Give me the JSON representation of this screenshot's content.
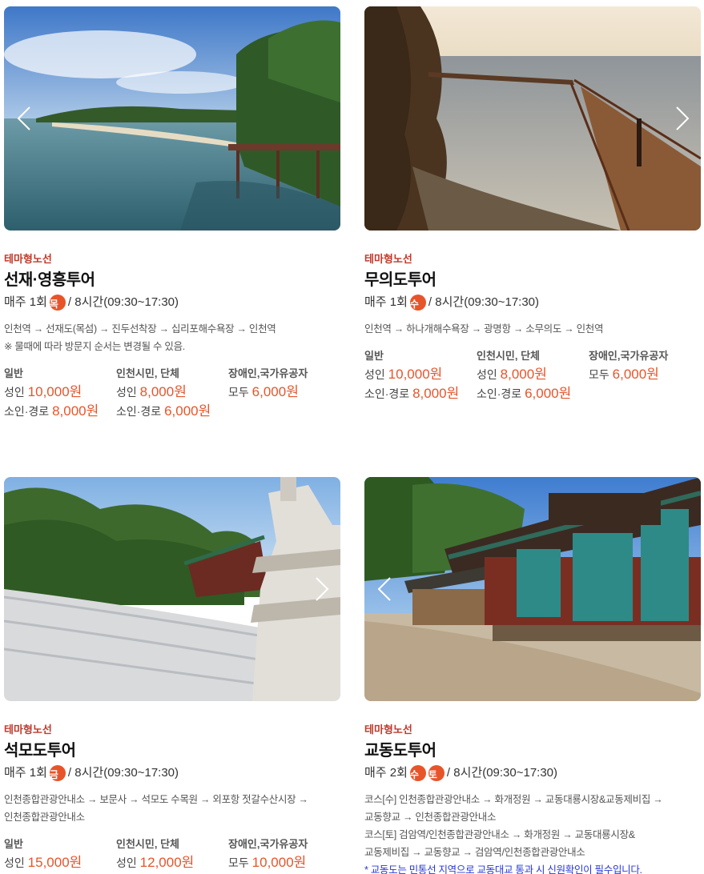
{
  "cards": [
    {
      "theme": "테마형노선",
      "title": "선재·영흥투어",
      "freq": "매주 1회",
      "days": [
        "목"
      ],
      "duration": "/ 8시간(09:30~17:30)",
      "route": [
        "인천역 → 선재도(목섬) → 진두선착장 → 십리포해수욕장 → 인천역",
        "※ 물때에 따라 방문지 순서는 변경될 수 있음."
      ],
      "prices": [
        {
          "heading": "일반",
          "rows": [
            {
              "label": "성인",
              "amount": "10,000원"
            },
            {
              "label": "소인·경로",
              "amount": "8,000원"
            }
          ]
        },
        {
          "heading": "인천시민, 단체",
          "rows": [
            {
              "label": "성인",
              "amount": "8,000원"
            },
            {
              "label": "소인·경로",
              "amount": "6,000원"
            }
          ]
        },
        {
          "heading": "장애인,국가유공자",
          "rows": [
            {
              "label": "모두",
              "amount": "6,000원"
            }
          ]
        }
      ]
    },
    {
      "theme": "테마형노선",
      "title": "무의도투어",
      "freq": "매주 1회",
      "days": [
        "수"
      ],
      "duration": "/ 8시간(09:30~17:30)",
      "route": [
        "인천역 → 하나개해수욕장 → 광명항 → 소무의도 → 인천역"
      ],
      "prices": [
        {
          "heading": "일반",
          "rows": [
            {
              "label": "성인",
              "amount": "10,000원"
            },
            {
              "label": "소인·경로",
              "amount": "8,000원"
            }
          ]
        },
        {
          "heading": "인천시민, 단체",
          "rows": [
            {
              "label": "성인",
              "amount": "8,000원"
            },
            {
              "label": "소인·경로",
              "amount": "6,000원"
            }
          ]
        },
        {
          "heading": "장애인,국가유공자",
          "rows": [
            {
              "label": "모두",
              "amount": "6,000원"
            }
          ]
        }
      ]
    },
    {
      "theme": "테마형노선",
      "title": "석모도투어",
      "freq": "매주 1회",
      "days": [
        "금"
      ],
      "duration": "/ 8시간(09:30~17:30)",
      "route": [
        "인천종합관광안내소 → 보문사 → 석모도 수목원 → 외포항 젓갈수산시장 →",
        "인천종합관광안내소"
      ],
      "prices": [
        {
          "heading": "일반",
          "rows": [
            {
              "label": "성인",
              "amount": "15,000원"
            }
          ]
        },
        {
          "heading": "인천시민, 단체",
          "rows": [
            {
              "label": "성인",
              "amount": "12,000원"
            }
          ]
        },
        {
          "heading": "장애인,국가유공자",
          "rows": [
            {
              "label": "모두",
              "amount": "10,000원"
            }
          ]
        }
      ]
    },
    {
      "theme": "테마형노선",
      "title": "교동도투어",
      "freq": "매주 2회",
      "days": [
        "수",
        "토"
      ],
      "duration": "/ 8시간(09:30~17:30)",
      "route": [
        "코스[수] 인천종합관광안내소 → 화개정원 → 교동대룡시장&교동제비집 →",
        "교동향교 → 인천종합관광안내소",
        "코스[토] 검암역/인천종합관광안내소 → 화개정원 → 교동대룡시장&",
        "교동제비집 → 교동향교 → 검암역/인천종합관광안내소"
      ],
      "note": "* 교동도는 민통선 지역으로 교동대교 통과 시 신원확인이 필수입니다."
    }
  ],
  "colors": {
    "accent": "#e8542a",
    "theme": "#c0392b",
    "note": "#2838d6"
  },
  "icons": {
    "prev": "chevron-left-icon",
    "next": "chevron-right-icon"
  }
}
